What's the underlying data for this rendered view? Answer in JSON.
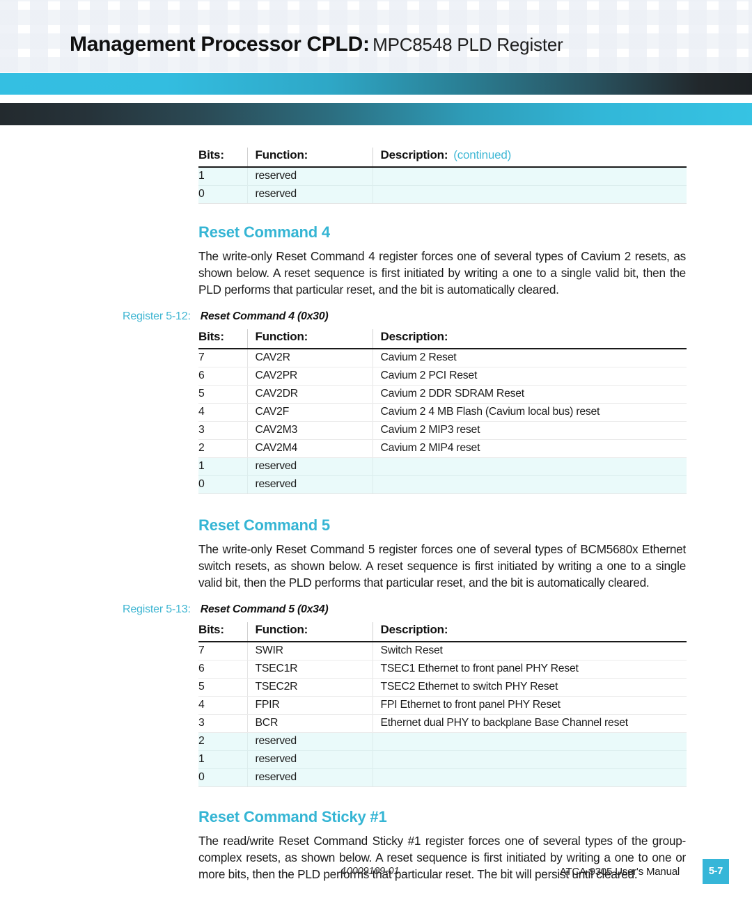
{
  "header": {
    "title_bold": "Management Processor CPLD:",
    "title_light": "MPC8548 PLD Register"
  },
  "tables": {
    "continued_table": {
      "headers": {
        "bits": "Bits:",
        "function": "Function:",
        "description": "Description:",
        "continued_note": "(continued)"
      },
      "rows": [
        {
          "bits": "1",
          "function": "reserved",
          "description": "",
          "reserved": true
        },
        {
          "bits": "0",
          "function": "reserved",
          "description": "",
          "reserved": true
        }
      ]
    },
    "reset_command_4": {
      "headers": {
        "bits": "Bits:",
        "function": "Function:",
        "description": "Description:"
      },
      "rows": [
        {
          "bits": "7",
          "function": "CAV2R",
          "description": "Cavium 2 Reset"
        },
        {
          "bits": "6",
          "function": "CAV2PR",
          "description": "Cavium 2 PCI Reset"
        },
        {
          "bits": "5",
          "function": "CAV2DR",
          "description": "Cavium 2 DDR SDRAM Reset"
        },
        {
          "bits": "4",
          "function": "CAV2F",
          "description": "Cavium 2 4 MB Flash (Cavium local bus) reset"
        },
        {
          "bits": "3",
          "function": "CAV2M3",
          "description": "Cavium 2 MIP3 reset"
        },
        {
          "bits": "2",
          "function": "CAV2M4",
          "description": "Cavium 2 MIP4 reset"
        },
        {
          "bits": "1",
          "function": "reserved",
          "description": "",
          "reserved": true
        },
        {
          "bits": "0",
          "function": "reserved",
          "description": "",
          "reserved": true
        }
      ]
    },
    "reset_command_5": {
      "headers": {
        "bits": "Bits:",
        "function": "Function:",
        "description": "Description:"
      },
      "rows": [
        {
          "bits": "7",
          "function": "SWIR",
          "description": "Switch Reset"
        },
        {
          "bits": "6",
          "function": "TSEC1R",
          "description": "TSEC1 Ethernet to front panel PHY Reset"
        },
        {
          "bits": "5",
          "function": "TSEC2R",
          "description": "TSEC2 Ethernet to switch PHY Reset"
        },
        {
          "bits": "4",
          "function": "FPIR",
          "description": "FPI Ethernet to front panel PHY Reset"
        },
        {
          "bits": "3",
          "function": "BCR",
          "description": "Ethernet dual PHY to backplane Base Channel reset"
        },
        {
          "bits": "2",
          "function": "reserved",
          "description": "",
          "reserved": true
        },
        {
          "bits": "1",
          "function": "reserved",
          "description": "",
          "reserved": true
        },
        {
          "bits": "0",
          "function": "reserved",
          "description": "",
          "reserved": true
        }
      ]
    }
  },
  "sections": {
    "reset_command_4": {
      "heading": "Reset Command 4",
      "body": "The write-only Reset Command 4 register forces one of several types of Cavium 2 resets, as shown below. A reset sequence is first initiated by writing a one to a single valid bit, then the PLD performs that particular reset, and the bit is automatically cleared.",
      "register_label": "Register 5-12:",
      "register_name": "Reset Command 4 (0x30)"
    },
    "reset_command_5": {
      "heading": "Reset Command 5",
      "body": "The write-only Reset Command 5 register forces one of several types of BCM5680x Ethernet switch resets, as shown below. A reset sequence is first initiated by writing a one to a single valid bit, then the PLD performs that particular reset, and the bit is automatically cleared.",
      "register_label": "Register 5-13:",
      "register_name": "Reset Command 5 (0x34)"
    },
    "reset_command_sticky_1": {
      "heading": "Reset Command Sticky #1",
      "body": "The read/write Reset Command Sticky #1 register forces one of several types of the group-complex resets, as shown below. A reset sequence is first initiated by writing a one to one or more bits, then the PLD performs that particular reset. The bit will persist until cleared."
    }
  },
  "footer": {
    "doc_number": "10009109-01",
    "manual_title": "ATCA-9305 User's Manual",
    "page_number": "5-7"
  },
  "colors": {
    "accent_cyan": "#35b5d4",
    "rule_cyan": "#34bfe2",
    "rule_dark": "#232a2e",
    "reserved_row_bg": "#eafafa",
    "page_box_bg": "#36b6d8"
  }
}
